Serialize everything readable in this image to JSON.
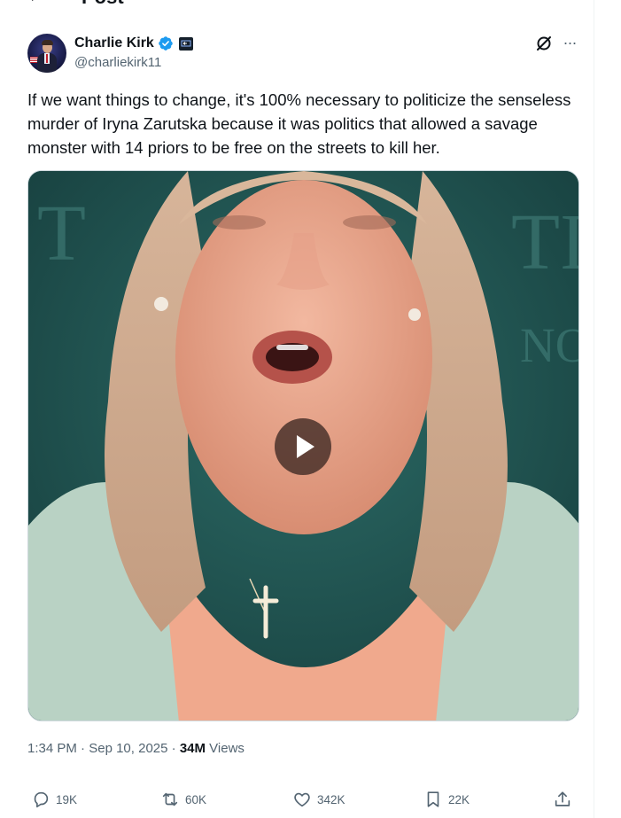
{
  "header": {
    "back_icon": "arrow-left-icon",
    "title": "Post"
  },
  "author": {
    "name": "Charlie Kirk",
    "handle": "@charliekirk11",
    "verified_color": "#1d9bf0",
    "affiliate_badge": "affiliate-badge-icon"
  },
  "post": {
    "text": "If we want things to change, it's 100% necessary to politicize the senseless murder of Iryna Zarutska because it was politics that allowed a savage monster with 14 priors to be free on the streets to kill her."
  },
  "media": {
    "type": "video",
    "play_icon": "play-icon"
  },
  "meta": {
    "time": "1:34 PM",
    "separator": "·",
    "date": "Sep 10, 2025",
    "views_count": "34M",
    "views_label": "Views"
  },
  "actions": {
    "replies": "19K",
    "reposts": "60K",
    "likes": "342K",
    "bookmarks": "22K"
  },
  "colors": {
    "text": "#0f1419",
    "secondary": "#536471",
    "accent": "#1d9bf0"
  }
}
